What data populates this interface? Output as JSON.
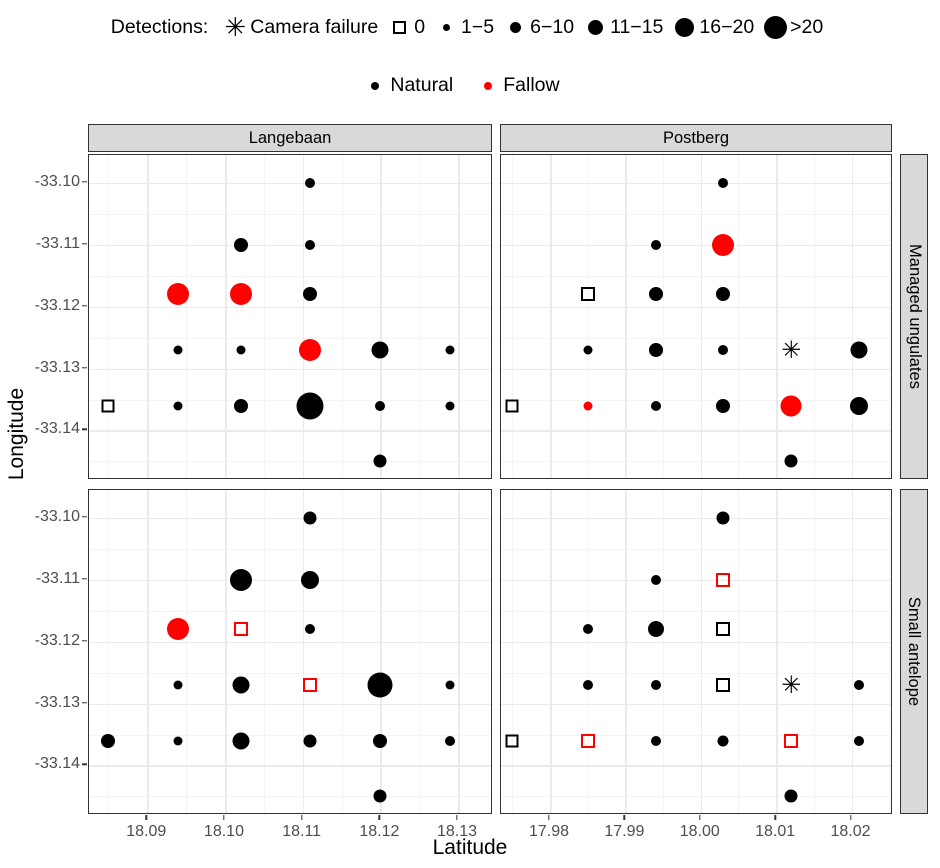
{
  "legend_size": {
    "title": "Detections:",
    "items": [
      {
        "key": "star",
        "label": "Camera failure"
      },
      {
        "key": "square",
        "label": "0"
      },
      {
        "key": "dot",
        "label": "1−5",
        "size": 7
      },
      {
        "key": "dot",
        "label": "6−10",
        "size": 11
      },
      {
        "key": "dot",
        "label": "11−15",
        "size": 15
      },
      {
        "key": "dot",
        "label": "16−20",
        "size": 19
      },
      {
        "key": "dot",
        "label": ">20",
        "size": 23
      }
    ]
  },
  "legend_color": {
    "items": [
      {
        "label": "Natural",
        "color": "#000000"
      },
      {
        "label": "Fallow",
        "color": "#FF0000"
      }
    ]
  },
  "axes": {
    "xlabel": "Latitude",
    "ylabel": "Longitude",
    "y_ticks": [
      "-33.10",
      "-33.11",
      "-33.12",
      "-33.13",
      "-33.14"
    ],
    "y_values": [
      -33.1,
      -33.11,
      -33.12,
      -33.13,
      -33.14
    ],
    "y_range": [
      -33.148,
      -33.0955
    ],
    "x_ticks_langebaan": [
      "18.09",
      "18.10",
      "18.11",
      "18.12",
      "18.13"
    ],
    "x_values_langebaan": [
      18.09,
      18.1,
      18.11,
      18.12,
      18.13
    ],
    "x_range_langebaan": [
      18.0825,
      18.1345
    ],
    "x_ticks_postberg": [
      "17.98",
      "17.99",
      "18.00",
      "18.01",
      "18.02"
    ],
    "x_values_postberg": [
      17.98,
      17.99,
      18.0,
      18.01,
      18.02
    ],
    "x_range_postberg": [
      17.9735,
      18.0255
    ]
  },
  "facets": {
    "cols": [
      "Langebaan",
      "Postberg"
    ],
    "rows": [
      "Managed ungulates",
      "Small antelope"
    ]
  },
  "chart_data": {
    "type": "scatter",
    "title": "",
    "xlabel": "Latitude",
    "ylabel": "Longitude",
    "grid": true,
    "legend_position": "top",
    "size_legend_title": "Detections:",
    "size_classes": [
      "Camera failure",
      "0",
      "1−5",
      "6−10",
      "11−15",
      "16−20",
      ">20"
    ],
    "color_classes": [
      {
        "name": "Natural",
        "color": "#000000"
      },
      {
        "name": "Fallow",
        "color": "#FF0000"
      }
    ],
    "facet_cols": [
      "Langebaan",
      "Postberg"
    ],
    "facet_rows": [
      "Managed ungulates",
      "Small antelope"
    ],
    "panels": [
      {
        "col": "Langebaan",
        "row": "Managed ungulates",
        "points": [
          {
            "x": 18.111,
            "y": -33.1,
            "class": "1−5",
            "group": "Natural",
            "shape": "circle",
            "size": 10
          },
          {
            "x": 18.102,
            "y": -33.11,
            "class": "6−10",
            "group": "Natural",
            "shape": "circle",
            "size": 14
          },
          {
            "x": 18.111,
            "y": -33.11,
            "class": "1−5",
            "group": "Natural",
            "shape": "circle",
            "size": 10
          },
          {
            "x": 18.094,
            "y": -33.118,
            "class": "16−20",
            "group": "Fallow",
            "shape": "circle",
            "size": 22
          },
          {
            "x": 18.102,
            "y": -33.118,
            "class": "16−20",
            "group": "Fallow",
            "shape": "circle",
            "size": 22
          },
          {
            "x": 18.111,
            "y": -33.118,
            "class": "6−10",
            "group": "Natural",
            "shape": "circle",
            "size": 14
          },
          {
            "x": 18.094,
            "y": -33.127,
            "class": "1−5",
            "group": "Natural",
            "shape": "circle",
            "size": 9
          },
          {
            "x": 18.102,
            "y": -33.127,
            "class": "1−5",
            "group": "Natural",
            "shape": "circle",
            "size": 9
          },
          {
            "x": 18.111,
            "y": -33.127,
            "class": "16−20",
            "group": "Fallow",
            "shape": "circle",
            "size": 22
          },
          {
            "x": 18.12,
            "y": -33.127,
            "class": "11−15",
            "group": "Natural",
            "shape": "circle",
            "size": 17
          },
          {
            "x": 18.129,
            "y": -33.127,
            "class": "1−5",
            "group": "Natural",
            "shape": "circle",
            "size": 9
          },
          {
            "x": 18.085,
            "y": -33.136,
            "class": "0",
            "group": "Natural",
            "shape": "square",
            "size": 13
          },
          {
            "x": 18.094,
            "y": -33.136,
            "class": "1−5",
            "group": "Natural",
            "shape": "circle",
            "size": 9
          },
          {
            "x": 18.102,
            "y": -33.136,
            "class": "6−10",
            "group": "Natural",
            "shape": "circle",
            "size": 14
          },
          {
            "x": 18.111,
            "y": -33.136,
            "class": ">20",
            "group": "Natural",
            "shape": "circle",
            "size": 27
          },
          {
            "x": 18.12,
            "y": -33.136,
            "class": "1−5",
            "group": "Natural",
            "shape": "circle",
            "size": 10
          },
          {
            "x": 18.129,
            "y": -33.136,
            "class": "1−5",
            "group": "Natural",
            "shape": "circle",
            "size": 9
          },
          {
            "x": 18.12,
            "y": -33.145,
            "class": "6−10",
            "group": "Natural",
            "shape": "circle",
            "size": 13
          }
        ]
      },
      {
        "col": "Postberg",
        "row": "Managed ungulates",
        "points": [
          {
            "x": 18.003,
            "y": -33.1,
            "class": "1−5",
            "group": "Natural",
            "shape": "circle",
            "size": 10
          },
          {
            "x": 17.994,
            "y": -33.11,
            "class": "1−5",
            "group": "Natural",
            "shape": "circle",
            "size": 10
          },
          {
            "x": 18.003,
            "y": -33.11,
            "class": "16−20",
            "group": "Fallow",
            "shape": "circle",
            "size": 22
          },
          {
            "x": 17.985,
            "y": -33.118,
            "class": "0",
            "group": "Natural",
            "shape": "square",
            "size": 14
          },
          {
            "x": 17.994,
            "y": -33.118,
            "class": "6−10",
            "group": "Natural",
            "shape": "circle",
            "size": 14
          },
          {
            "x": 18.003,
            "y": -33.118,
            "class": "6−10",
            "group": "Natural",
            "shape": "circle",
            "size": 14
          },
          {
            "x": 17.985,
            "y": -33.127,
            "class": "1−5",
            "group": "Natural",
            "shape": "circle",
            "size": 9
          },
          {
            "x": 17.994,
            "y": -33.127,
            "class": "6−10",
            "group": "Natural",
            "shape": "circle",
            "size": 14
          },
          {
            "x": 18.003,
            "y": -33.127,
            "class": "1−5",
            "group": "Natural",
            "shape": "circle",
            "size": 10
          },
          {
            "x": 18.012,
            "y": -33.127,
            "class": "Camera failure",
            "group": "Natural",
            "shape": "star",
            "size": 24
          },
          {
            "x": 18.021,
            "y": -33.127,
            "class": "11−15",
            "group": "Natural",
            "shape": "circle",
            "size": 17
          },
          {
            "x": 17.975,
            "y": -33.136,
            "class": "0",
            "group": "Natural",
            "shape": "square",
            "size": 13
          },
          {
            "x": 17.985,
            "y": -33.136,
            "class": "1−5",
            "group": "Fallow",
            "shape": "circle",
            "size": 9
          },
          {
            "x": 17.994,
            "y": -33.136,
            "class": "1−5",
            "group": "Natural",
            "shape": "circle",
            "size": 10
          },
          {
            "x": 18.003,
            "y": -33.136,
            "class": "6−10",
            "group": "Natural",
            "shape": "circle",
            "size": 14
          },
          {
            "x": 18.012,
            "y": -33.136,
            "class": "16−20",
            "group": "Fallow",
            "shape": "circle",
            "size": 21
          },
          {
            "x": 18.021,
            "y": -33.136,
            "class": "11−15",
            "group": "Natural",
            "shape": "circle",
            "size": 18
          },
          {
            "x": 18.012,
            "y": -33.145,
            "class": "6−10",
            "group": "Natural",
            "shape": "circle",
            "size": 13
          }
        ]
      },
      {
        "col": "Langebaan",
        "row": "Small antelope",
        "points": [
          {
            "x": 18.111,
            "y": -33.1,
            "class": "6−10",
            "group": "Natural",
            "shape": "circle",
            "size": 13
          },
          {
            "x": 18.102,
            "y": -33.11,
            "class": "16−20",
            "group": "Natural",
            "shape": "circle",
            "size": 22
          },
          {
            "x": 18.111,
            "y": -33.11,
            "class": "11−15",
            "group": "Natural",
            "shape": "circle",
            "size": 18
          },
          {
            "x": 18.094,
            "y": -33.118,
            "class": "16−20",
            "group": "Fallow",
            "shape": "circle",
            "size": 22
          },
          {
            "x": 18.102,
            "y": -33.118,
            "class": "0",
            "group": "Fallow",
            "shape": "square",
            "size": 14
          },
          {
            "x": 18.111,
            "y": -33.118,
            "class": "1−5",
            "group": "Natural",
            "shape": "circle",
            "size": 10
          },
          {
            "x": 18.094,
            "y": -33.127,
            "class": "1−5",
            "group": "Natural",
            "shape": "circle",
            "size": 9
          },
          {
            "x": 18.102,
            "y": -33.127,
            "class": "11−15",
            "group": "Natural",
            "shape": "circle",
            "size": 17
          },
          {
            "x": 18.111,
            "y": -33.127,
            "class": "0",
            "group": "Fallow",
            "shape": "square",
            "size": 14
          },
          {
            "x": 18.12,
            "y": -33.127,
            "class": ">20",
            "group": "Natural",
            "shape": "circle",
            "size": 25
          },
          {
            "x": 18.129,
            "y": -33.127,
            "class": "1−5",
            "group": "Natural",
            "shape": "circle",
            "size": 9
          },
          {
            "x": 18.085,
            "y": -33.136,
            "class": "6−10",
            "group": "Natural",
            "shape": "circle",
            "size": 14
          },
          {
            "x": 18.094,
            "y": -33.136,
            "class": "1−5",
            "group": "Natural",
            "shape": "circle",
            "size": 9
          },
          {
            "x": 18.102,
            "y": -33.136,
            "class": "11−15",
            "group": "Natural",
            "shape": "circle",
            "size": 17
          },
          {
            "x": 18.111,
            "y": -33.136,
            "class": "6−10",
            "group": "Natural",
            "shape": "circle",
            "size": 13
          },
          {
            "x": 18.12,
            "y": -33.136,
            "class": "6−10",
            "group": "Natural",
            "shape": "circle",
            "size": 14
          },
          {
            "x": 18.129,
            "y": -33.136,
            "class": "1−5",
            "group": "Natural",
            "shape": "circle",
            "size": 10
          },
          {
            "x": 18.12,
            "y": -33.145,
            "class": "6−10",
            "group": "Natural",
            "shape": "circle",
            "size": 13
          }
        ]
      },
      {
        "col": "Postberg",
        "row": "Small antelope",
        "points": [
          {
            "x": 18.003,
            "y": -33.1,
            "class": "6−10",
            "group": "Natural",
            "shape": "circle",
            "size": 13
          },
          {
            "x": 17.994,
            "y": -33.11,
            "class": "1−5",
            "group": "Natural",
            "shape": "circle",
            "size": 10
          },
          {
            "x": 18.003,
            "y": -33.11,
            "class": "0",
            "group": "Fallow",
            "shape": "square",
            "size": 14
          },
          {
            "x": 17.985,
            "y": -33.118,
            "class": "1−5",
            "group": "Natural",
            "shape": "circle",
            "size": 10
          },
          {
            "x": 17.994,
            "y": -33.118,
            "class": "11−15",
            "group": "Natural",
            "shape": "circle",
            "size": 16
          },
          {
            "x": 18.003,
            "y": -33.118,
            "class": "0",
            "group": "Natural",
            "shape": "square",
            "size": 14
          },
          {
            "x": 17.985,
            "y": -33.127,
            "class": "1−5",
            "group": "Natural",
            "shape": "circle",
            "size": 10
          },
          {
            "x": 17.994,
            "y": -33.127,
            "class": "1−5",
            "group": "Natural",
            "shape": "circle",
            "size": 10
          },
          {
            "x": 18.003,
            "y": -33.127,
            "class": "0",
            "group": "Natural",
            "shape": "square",
            "size": 14
          },
          {
            "x": 18.012,
            "y": -33.127,
            "class": "Camera failure",
            "group": "Natural",
            "shape": "star",
            "size": 24
          },
          {
            "x": 18.021,
            "y": -33.127,
            "class": "1−5",
            "group": "Natural",
            "shape": "circle",
            "size": 10
          },
          {
            "x": 17.975,
            "y": -33.136,
            "class": "0",
            "group": "Natural",
            "shape": "square",
            "size": 13
          },
          {
            "x": 17.985,
            "y": -33.136,
            "class": "0",
            "group": "Fallow",
            "shape": "square",
            "size": 14
          },
          {
            "x": 17.994,
            "y": -33.136,
            "class": "1−5",
            "group": "Natural",
            "shape": "circle",
            "size": 10
          },
          {
            "x": 18.003,
            "y": -33.136,
            "class": "1−5",
            "group": "Natural",
            "shape": "circle",
            "size": 11
          },
          {
            "x": 18.012,
            "y": -33.136,
            "class": "0",
            "group": "Fallow",
            "shape": "square",
            "size": 14
          },
          {
            "x": 18.021,
            "y": -33.136,
            "class": "1−5",
            "group": "Natural",
            "shape": "circle",
            "size": 10
          },
          {
            "x": 18.012,
            "y": -33.145,
            "class": "6−10",
            "group": "Natural",
            "shape": "circle",
            "size": 13
          }
        ]
      }
    ]
  }
}
